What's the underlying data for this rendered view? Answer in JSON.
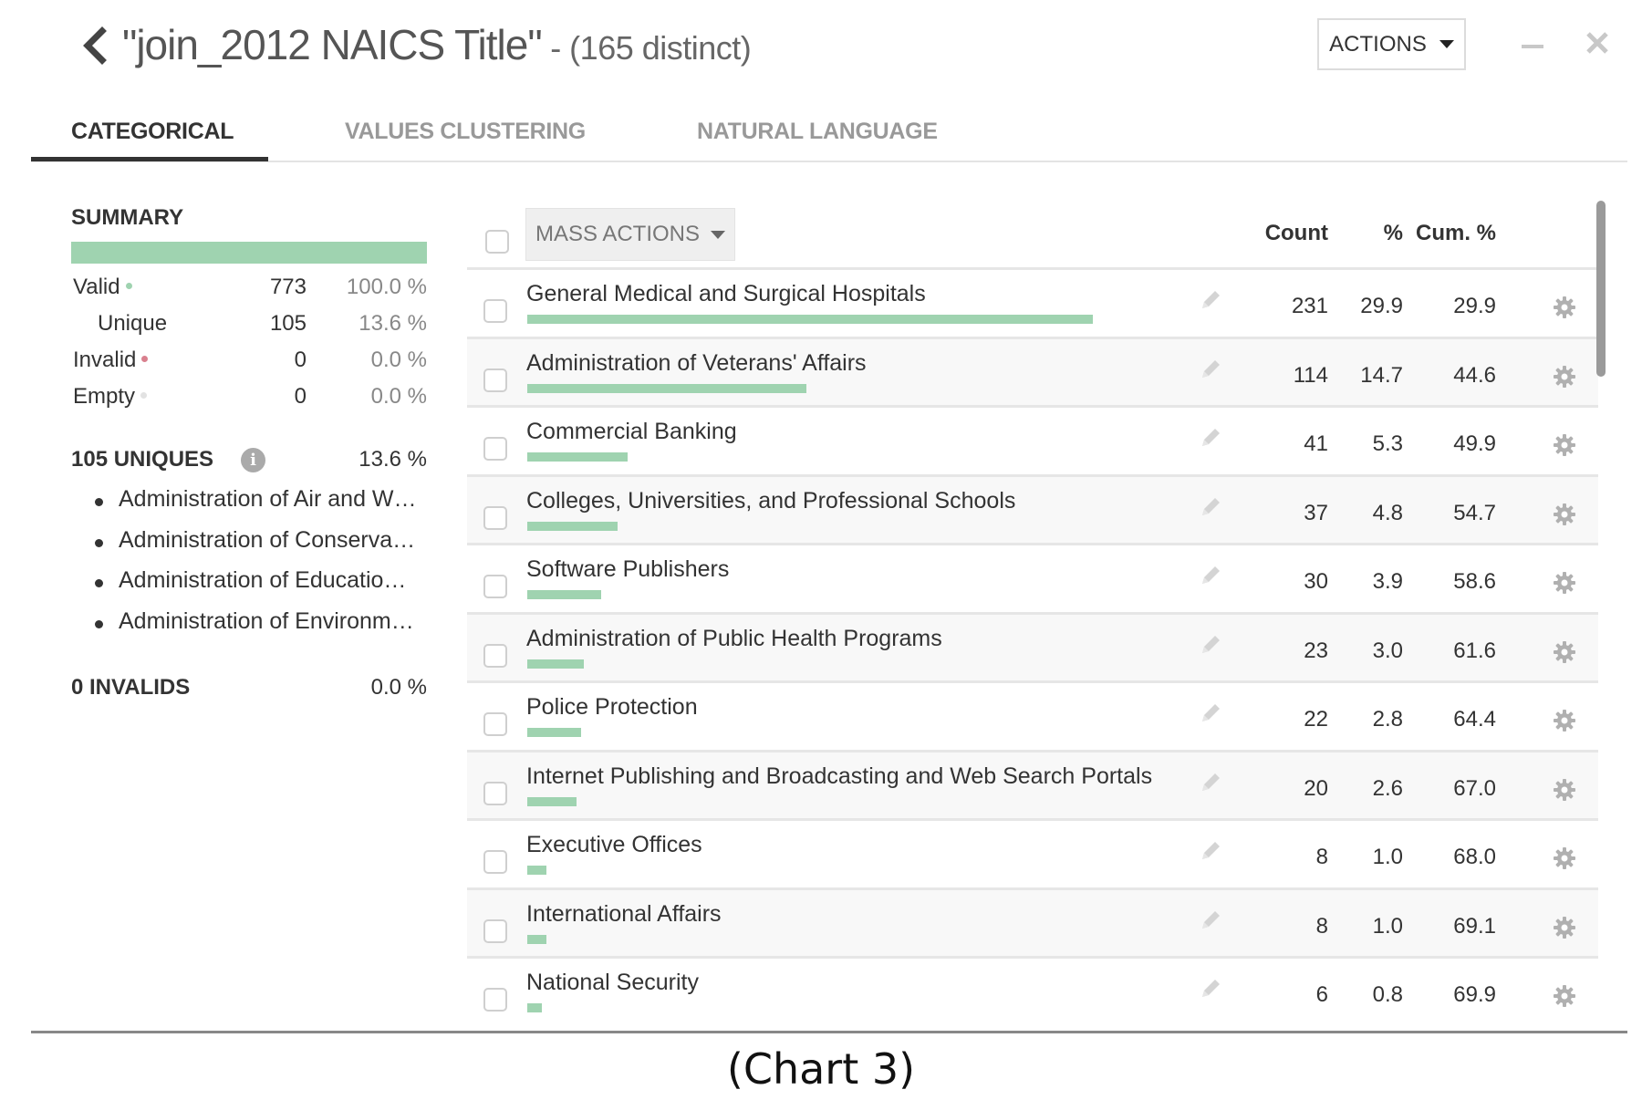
{
  "header": {
    "title": "\"join_2012 NAICS Title\"",
    "subtitle": " - (165 distinct)",
    "actions_label": "ACTIONS"
  },
  "tabs": [
    {
      "label": "CATEGORICAL",
      "active": true
    },
    {
      "label": "VALUES CLUSTERING",
      "active": false
    },
    {
      "label": "NATURAL LANGUAGE",
      "active": false
    }
  ],
  "summary": {
    "title": "SUMMARY",
    "valid_fraction": 1.0,
    "rows": [
      {
        "label": "Valid",
        "count": "773",
        "pct": "100.0 %",
        "dot_color": "#9fd3b0"
      },
      {
        "label": "Unique",
        "count": "105",
        "pct": "13.6 %",
        "dot_color": null
      },
      {
        "label": "Invalid",
        "count": "0",
        "pct": "0.0 %",
        "dot_color": "#d9808e"
      },
      {
        "label": "Empty",
        "count": "0",
        "pct": "0.0 %",
        "dot_color": "#e2e2e2"
      }
    ]
  },
  "uniques": {
    "title": "105 UNIQUES",
    "pct": "13.6 %",
    "items": [
      "Administration of Air and W…",
      "Administration of Conserva…",
      "Administration of Educatio…",
      "Administration of Environm…"
    ]
  },
  "invalids": {
    "title": "0 INVALIDS",
    "pct": "0.0 %"
  },
  "table": {
    "mass_actions_label": "MASS ACTIONS",
    "columns": {
      "count": "Count",
      "pct": "%",
      "cum": "Cum. %"
    },
    "max_count": 231,
    "rows": [
      {
        "value": "General Medical and Surgical Hospitals",
        "count": "231",
        "pct": "29.9",
        "cum": "29.9"
      },
      {
        "value": "Administration of Veterans' Affairs",
        "count": "114",
        "pct": "14.7",
        "cum": "44.6"
      },
      {
        "value": "Commercial Banking",
        "count": "41",
        "pct": "5.3",
        "cum": "49.9"
      },
      {
        "value": "Colleges, Universities, and Professional Schools",
        "count": "37",
        "pct": "4.8",
        "cum": "54.7"
      },
      {
        "value": "Software Publishers",
        "count": "30",
        "pct": "3.9",
        "cum": "58.6"
      },
      {
        "value": "Administration of Public Health Programs",
        "count": "23",
        "pct": "3.0",
        "cum": "61.6"
      },
      {
        "value": "Police Protection",
        "count": "22",
        "pct": "2.8",
        "cum": "64.4"
      },
      {
        "value": "Internet Publishing and Broadcasting and Web Search Portals",
        "count": "20",
        "pct": "2.6",
        "cum": "67.0"
      },
      {
        "value": "Executive Offices",
        "count": "8",
        "pct": "1.0",
        "cum": "68.0"
      },
      {
        "value": "International Affairs",
        "count": "8",
        "pct": "1.0",
        "cum": "69.1"
      },
      {
        "value": "National Security",
        "count": "6",
        "pct": "0.8",
        "cum": "69.9"
      }
    ]
  },
  "caption": "(Chart 3)",
  "colors": {
    "bar": "#9fd3b0",
    "text": "#333333",
    "muted": "#999999"
  }
}
